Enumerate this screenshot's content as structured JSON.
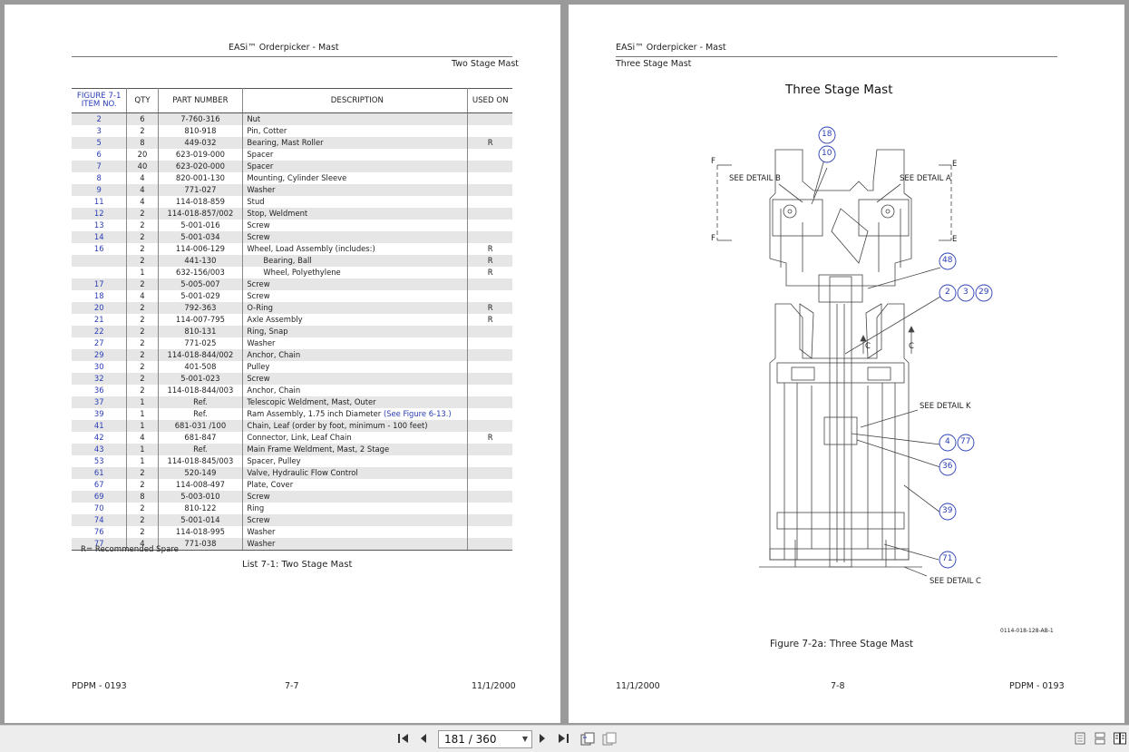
{
  "left_page": {
    "header_title": "EASi™ Orderpicker - Mast",
    "section_title": "Two Stage Mast",
    "columns": {
      "figure_line1": "FIGURE 7-1",
      "figure_line2": "ITEM NO.",
      "qty": "QTY",
      "part_number": "PART NUMBER",
      "description": "DESCRIPTION",
      "used_on": "USED ON"
    },
    "rows": [
      {
        "item": "2",
        "qty": "6",
        "part": "7-760-316",
        "desc": "Nut",
        "used": ""
      },
      {
        "item": "3",
        "qty": "2",
        "part": "810-918",
        "desc": "Pin, Cotter",
        "used": ""
      },
      {
        "item": "5",
        "qty": "8",
        "part": "449-032",
        "desc": "Bearing, Mast Roller",
        "used": "R"
      },
      {
        "item": "6",
        "qty": "20",
        "part": "623-019-000",
        "desc": "Spacer",
        "used": ""
      },
      {
        "item": "7",
        "qty": "40",
        "part": "623-020-000",
        "desc": "Spacer",
        "used": ""
      },
      {
        "item": "8",
        "qty": "4",
        "part": "820-001-130",
        "desc": "Mounting, Cylinder Sleeve",
        "used": ""
      },
      {
        "item": "9",
        "qty": "4",
        "part": "771-027",
        "desc": "Washer",
        "used": ""
      },
      {
        "item": "11",
        "qty": "4",
        "part": "114-018-859",
        "desc": "Stud",
        "used": ""
      },
      {
        "item": "12",
        "qty": "2",
        "part": "114-018-857/002",
        "desc": "Stop, Weldment",
        "used": ""
      },
      {
        "item": "13",
        "qty": "2",
        "part": "5-001-016",
        "desc": "Screw",
        "used": ""
      },
      {
        "item": "14",
        "qty": "2",
        "part": "5-001-034",
        "desc": "Screw",
        "used": ""
      },
      {
        "item": "16",
        "qty": "2",
        "part": "114-006-129",
        "desc": "Wheel, Load Assembly (includes:)",
        "used": "R"
      },
      {
        "item": "",
        "qty": "2",
        "part": "441-130",
        "desc": "Bearing, Ball",
        "used": "R",
        "indent": true
      },
      {
        "item": "",
        "qty": "1",
        "part": "632-156/003",
        "desc": "Wheel, Polyethylene",
        "used": "R",
        "indent": true
      },
      {
        "item": "17",
        "qty": "2",
        "part": "5-005-007",
        "desc": "Screw",
        "used": ""
      },
      {
        "item": "18",
        "qty": "4",
        "part": "5-001-029",
        "desc": "Screw",
        "used": ""
      },
      {
        "item": "20",
        "qty": "2",
        "part": "792-363",
        "desc": "O-Ring",
        "used": "R"
      },
      {
        "item": "21",
        "qty": "2",
        "part": "114-007-795",
        "desc": "Axle Assembly",
        "used": "R"
      },
      {
        "item": "22",
        "qty": "2",
        "part": "810-131",
        "desc": "Ring, Snap",
        "used": ""
      },
      {
        "item": "27",
        "qty": "2",
        "part": "771-025",
        "desc": "Washer",
        "used": ""
      },
      {
        "item": "29",
        "qty": "2",
        "part": "114-018-844/002",
        "desc": "Anchor, Chain",
        "used": ""
      },
      {
        "item": "30",
        "qty": "2",
        "part": "401-508",
        "desc": "Pulley",
        "used": ""
      },
      {
        "item": "32",
        "qty": "2",
        "part": "5-001-023",
        "desc": "Screw",
        "used": ""
      },
      {
        "item": "36",
        "qty": "2",
        "part": "114-018-844/003",
        "desc": "Anchor, Chain",
        "used": ""
      },
      {
        "item": "37",
        "qty": "1",
        "part": "Ref.",
        "desc": "Telescopic Weldment, Mast, Outer",
        "used": ""
      },
      {
        "item": "39",
        "qty": "1",
        "part": "Ref.",
        "desc": "Ram Assembly, 1.75 inch Diameter",
        "link": "(See Figure 6-13.)",
        "used": ""
      },
      {
        "item": "41",
        "qty": "1",
        "part": "681-031 /100",
        "desc": "Chain, Leaf (order by foot, minimum - 100 feet)",
        "used": ""
      },
      {
        "item": "42",
        "qty": "4",
        "part": "681-847",
        "desc": "Connector, Link, Leaf Chain",
        "used": "R"
      },
      {
        "item": "43",
        "qty": "1",
        "part": "Ref.",
        "desc": "Main Frame Weldment, Mast, 2 Stage",
        "used": ""
      },
      {
        "item": "53",
        "qty": "1",
        "part": "114-018-845/003",
        "desc": "Spacer, Pulley",
        "used": ""
      },
      {
        "item": "61",
        "qty": "2",
        "part": "520-149",
        "desc": "Valve, Hydraulic Flow Control",
        "used": ""
      },
      {
        "item": "67",
        "qty": "2",
        "part": "114-008-497",
        "desc": "Plate, Cover",
        "used": ""
      },
      {
        "item": "69",
        "qty": "8",
        "part": "5-003-010",
        "desc": "Screw",
        "used": ""
      },
      {
        "item": "70",
        "qty": "2",
        "part": "810-122",
        "desc": "Ring",
        "used": ""
      },
      {
        "item": "74",
        "qty": "2",
        "part": "5-001-014",
        "desc": "Screw",
        "used": ""
      },
      {
        "item": "76",
        "qty": "2",
        "part": "114-018-995",
        "desc": "Washer",
        "used": ""
      },
      {
        "item": "77",
        "qty": "4",
        "part": "771-038",
        "desc": "Washer",
        "used": ""
      }
    ],
    "note": "R= Recommended Spare",
    "caption": "List 7-1:  Two Stage Mast",
    "footer": {
      "left": "PDPM - 0193",
      "center": "7-7",
      "right": "11/1/2000"
    }
  },
  "right_page": {
    "header_title": "EASi™ Orderpicker - Mast",
    "section_title": "Three Stage Mast",
    "figure_title": "Three Stage Mast",
    "labels": {
      "detail_b": "SEE DETAIL B",
      "detail_a": "SEE DETAIL A",
      "detail_k": "SEE DETAIL K",
      "detail_c": "SEE DETAIL C",
      "f": "F",
      "e": "E",
      "c": "C"
    },
    "callouts": [
      "18",
      "10",
      "48",
      "2",
      "3",
      "29",
      "4",
      "77",
      "36",
      "39",
      "71"
    ],
    "drawing_number": "0114-018-128-AB-1",
    "caption": "Figure 7-2a:  Three Stage Mast",
    "footer": {
      "left": "11/1/2000",
      "center": "7-8",
      "right": "PDPM - 0193"
    }
  },
  "toolbar": {
    "page_display": "181 / 360"
  }
}
